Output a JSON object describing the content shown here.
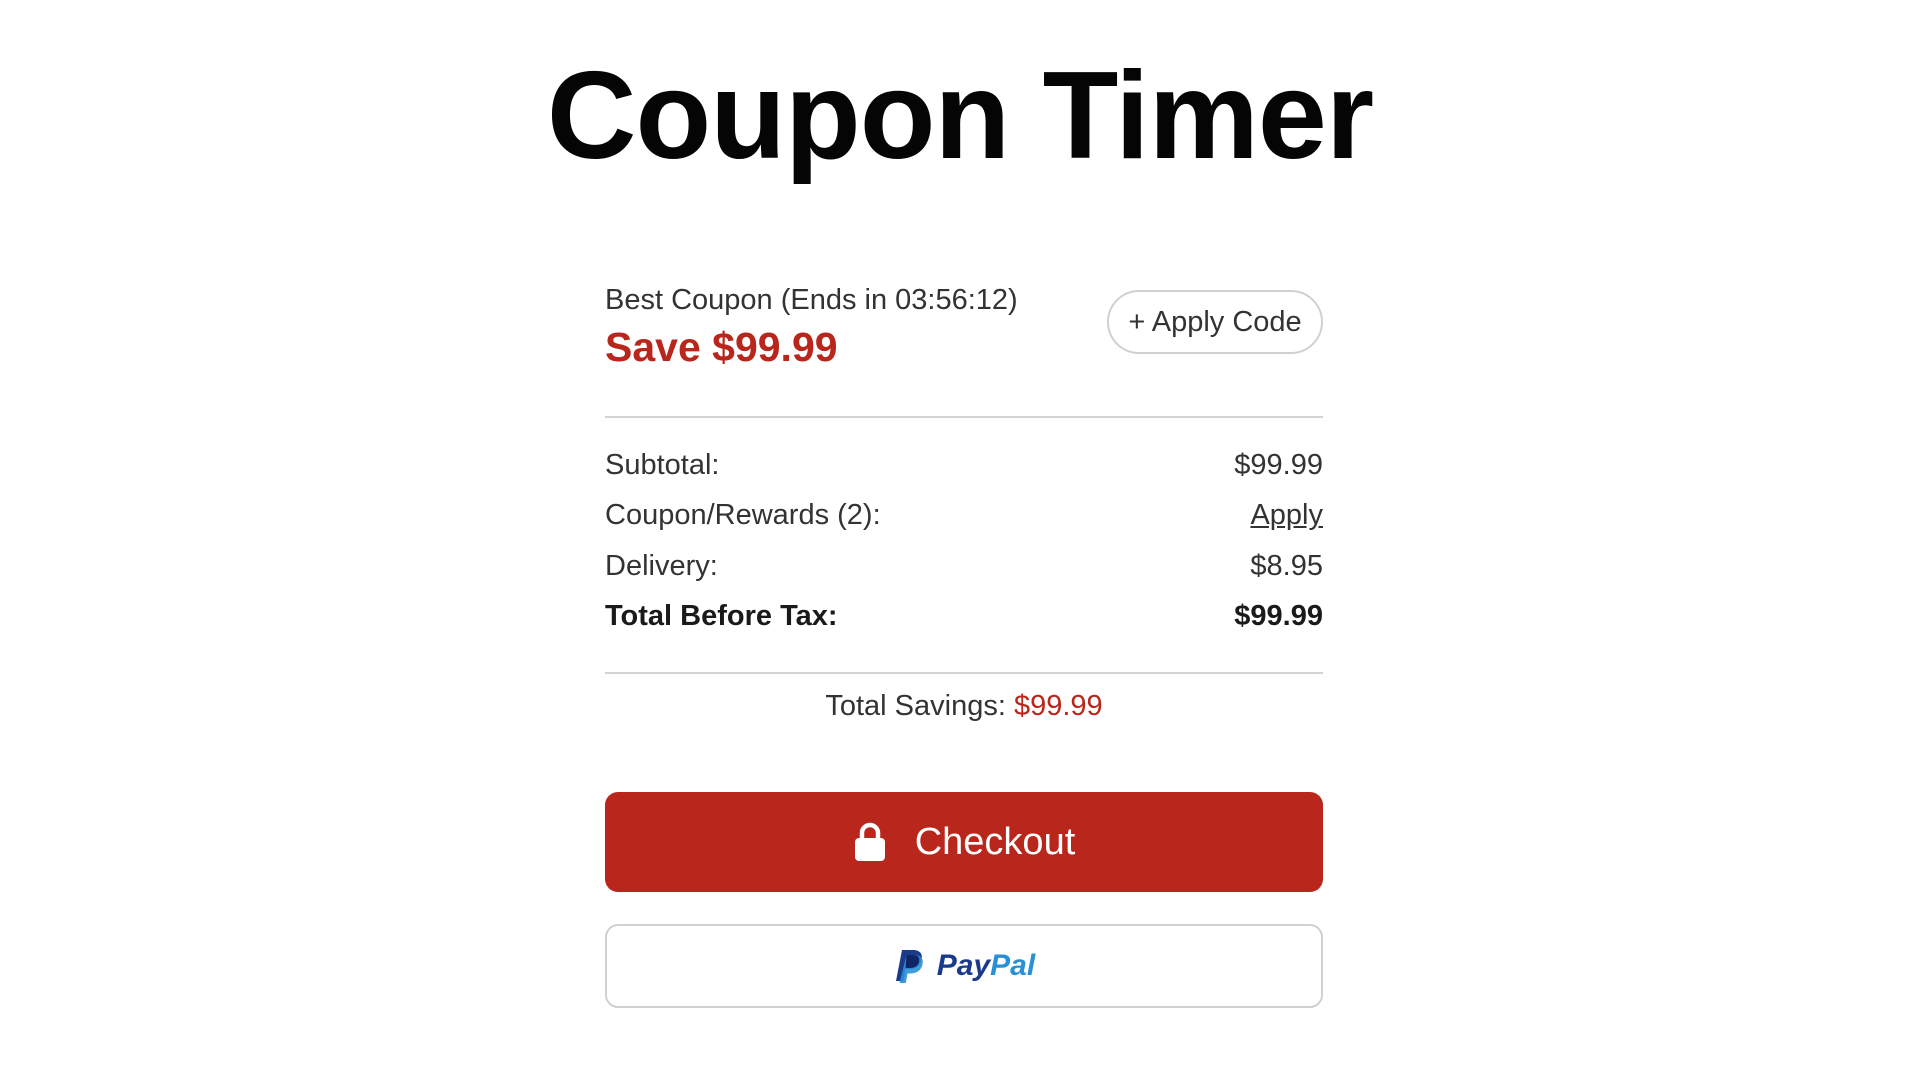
{
  "page": {
    "title": "Coupon Timer"
  },
  "coupon": {
    "caption": "Best Coupon (Ends in 03:56:12)",
    "save_text": "Save $99.99",
    "apply_code_label": "+ Apply Code"
  },
  "summary": {
    "rows": [
      {
        "label": "Subtotal:",
        "value": "$99.99"
      },
      {
        "label": "Coupon/Rewards (2):",
        "value": "Apply"
      },
      {
        "label": "Delivery:",
        "value": "$8.95"
      },
      {
        "label": "Total Before Tax:",
        "value": "$99.99"
      }
    ]
  },
  "savings": {
    "label": "Total Savings: ",
    "amount": "$99.99"
  },
  "checkout": {
    "label": "Checkout",
    "icon": "lock-icon"
  },
  "paypal": {
    "text_dark": "Pay",
    "text_light": "Pal",
    "icon": "paypal-icon"
  },
  "colors": {
    "accent": "#b9261c",
    "paypal_dark": "#1b3b8a",
    "paypal_light": "#2a90d6"
  }
}
